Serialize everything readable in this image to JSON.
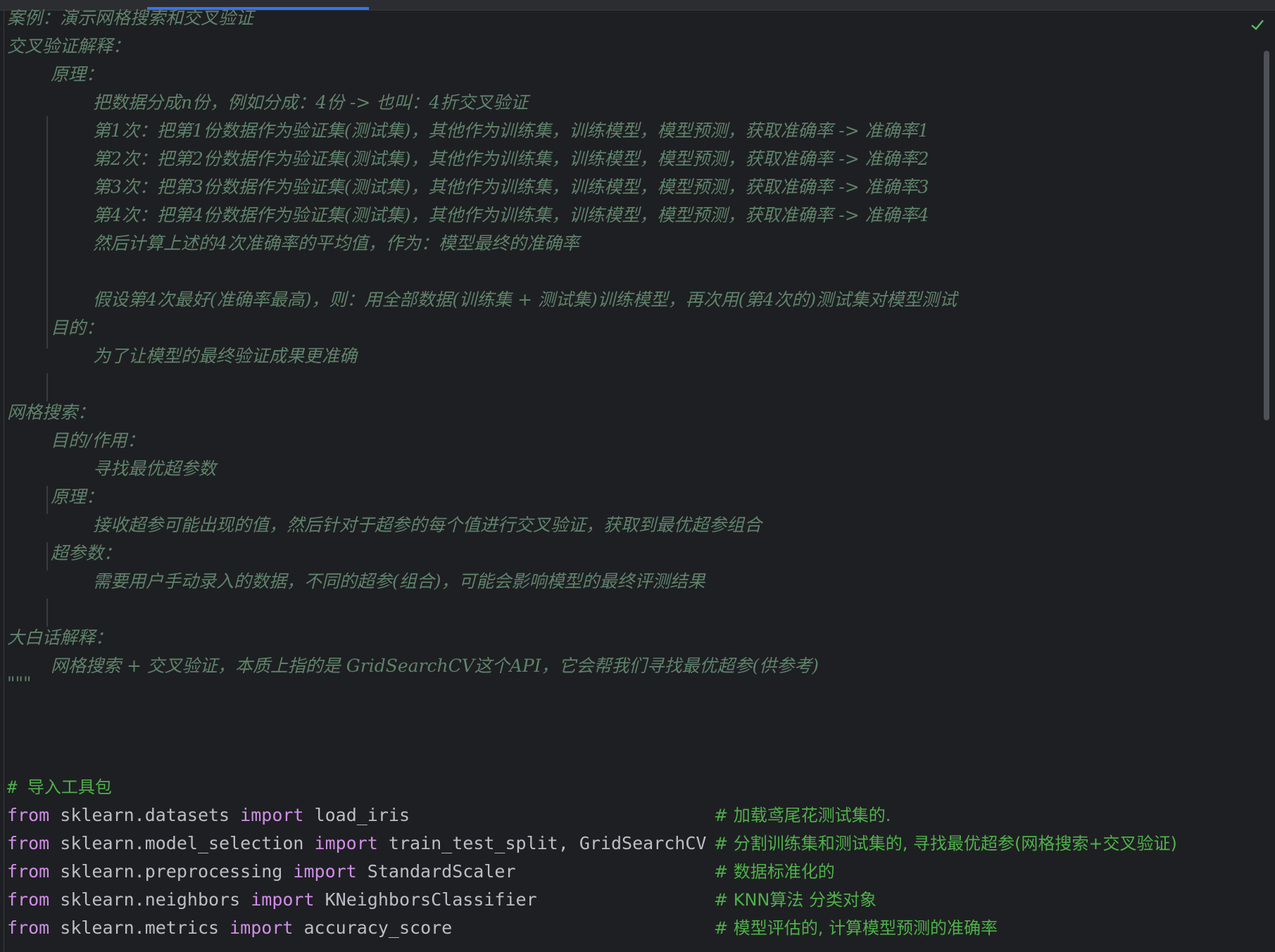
{
  "editor": {
    "status_icon": "check-icon",
    "colors": {
      "background": "#1e1f22",
      "docstring": "#5f826b",
      "keyword": "#cf8ee6",
      "identifier": "#bcbec4",
      "comment": "#4fb04a",
      "accent": "#3574f0"
    }
  },
  "docstring": {
    "l01": "案例：演示网格搜索和交叉验证",
    "l02": "交叉验证解释：",
    "l03": "原理：",
    "l04": "把数据分成n份，例如分成：4份 -> 也叫：4折交叉验证",
    "l05": "第1次：把第1份数据作为验证集(测试集)，其他作为训练集，训练模型，模型预测，获取准确率 -> 准确率1",
    "l06": "第2次：把第2份数据作为验证集(测试集)，其他作为训练集，训练模型，模型预测，获取准确率 -> 准确率2",
    "l07": "第3次：把第3份数据作为验证集(测试集)，其他作为训练集，训练模型，模型预测，获取准确率 -> 准确率3",
    "l08": "第4次：把第4份数据作为验证集(测试集)，其他作为训练集，训练模型，模型预测，获取准确率 -> 准确率4",
    "l09": "然后计算上述的4次准确率的平均值，作为：模型最终的准确率",
    "l10": "假设第4次最好(准确率最高)，则：用全部数据(训练集 + 测试集)训练模型，再次用(第4次的)测试集对模型测试",
    "l11": "目的：",
    "l12": "为了让模型的最终验证成果更准确",
    "l13": "网格搜索：",
    "l14": "目的/作用：",
    "l15": "寻找最优超参数",
    "l16": "原理：",
    "l17": "接收超参可能出现的值，然后针对于超参的每个值进行交叉验证，获取到最优超参组合",
    "l18": "超参数：",
    "l19": "需要用户手动录入的数据，不同的超参(组合)，可能会影响模型的最终评测结果",
    "l20": "大白话解释：",
    "l21": "网格搜索 + 交叉验证，本质上指的是 GridSearchCV这个API，它会帮我们寻找最优超参(供参考)",
    "l22": "\"\"\""
  },
  "imports": {
    "header_comment": "# 导入工具包",
    "lines": [
      {
        "from": "from",
        "module": "sklearn.datasets",
        "import": "import",
        "names": "load_iris",
        "comment": "# 加载鸢尾花测试集的."
      },
      {
        "from": "from",
        "module": "sklearn.model_selection",
        "import": "import",
        "names": "train_test_split, GridSearchCV",
        "comment": "# 分割训练集和测试集的, 寻找最优超参(网格搜索+交叉验证)"
      },
      {
        "from": "from",
        "module": "sklearn.preprocessing",
        "import": "import",
        "names": "StandardScaler",
        "comment": "# 数据标准化的"
      },
      {
        "from": "from",
        "module": "sklearn.neighbors",
        "import": "import",
        "names": "KNeighborsClassifier",
        "comment": "# KNN算法 分类对象"
      },
      {
        "from": "from",
        "module": "sklearn.metrics",
        "import": "import",
        "names": "accuracy_score",
        "comment": "# 模型评估的, 计算模型预测的准确率"
      }
    ]
  }
}
